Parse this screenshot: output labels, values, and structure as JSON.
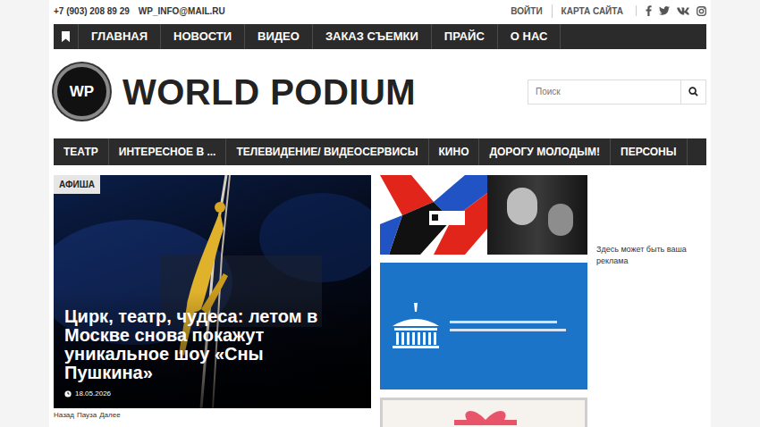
{
  "topbar": {
    "phone": "+7 (903) 208 89 29",
    "email": "WP_INFO@MAIL.RU",
    "links": [
      "ВОЙТИ",
      "КАРТА САЙТА"
    ]
  },
  "main_nav": [
    {
      "label": "ГЛАВНАЯ"
    },
    {
      "label": "НОВОСТИ"
    },
    {
      "label": "ВИДЕО"
    },
    {
      "label": "ЗАКАЗ СЪЕМКИ"
    },
    {
      "label": "ПРАЙС"
    },
    {
      "label": "О НАС"
    }
  ],
  "site": {
    "logo": "WP",
    "title": "WORLD PODIUM"
  },
  "search": {
    "placeholder": "Поиск"
  },
  "category_nav": [
    {
      "label": "ТЕАТР"
    },
    {
      "label": "ИНТЕРЕСНОЕ В ..."
    },
    {
      "label": "ТЕЛЕВИДЕНИЕ/ ВИДЕОСЕРВИСЫ"
    },
    {
      "label": "КИНО"
    },
    {
      "label": "ДОРОГУ МОЛОДЫМ!"
    },
    {
      "label": "ПЕРСОНЫ"
    }
  ],
  "featured": {
    "badge": "АФИША",
    "title": "Цирк, театр, чудеса: летом в Москве снова покажут уникальное шоу «Сны Пушкина»",
    "date": "18.05.2026"
  },
  "slider_controls": [
    "Назад",
    "Пауза",
    "Далее"
  ],
  "ad_text": "Здесь может быть ваша реклама"
}
